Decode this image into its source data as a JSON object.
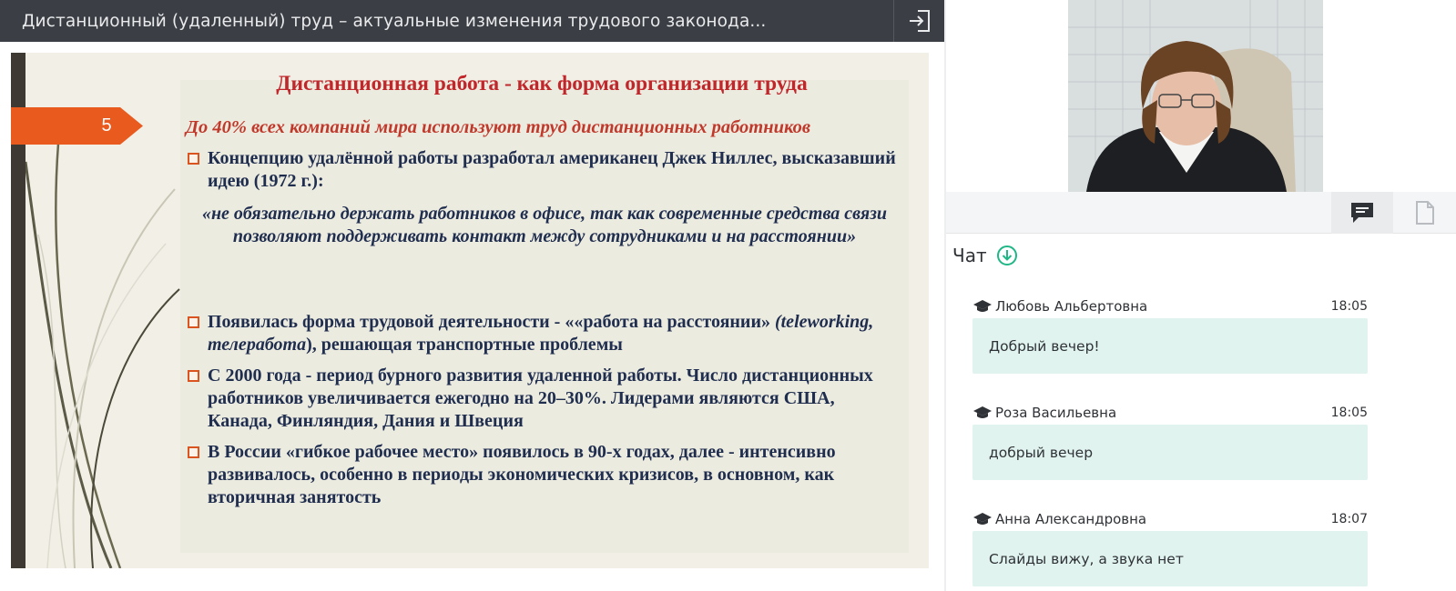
{
  "header": {
    "title": "Дистанционный (удаленный) труд – актуальные изменения трудового законода..."
  },
  "slide": {
    "number": "5",
    "title": "Дистанционная работа - как форма организации труда",
    "subtitle": "До 40% всех компаний мира используют труд дистанционных работников",
    "bullet1": "Концепцию удалённой работы разработал американец Джек Ниллес, высказавший идею (1972 г.):",
    "quote": "«не обязательно держать работников в офисе, так как современные средства связи позволяют поддерживать контакт между сотрудниками и на расстоянии»",
    "bullet2_a": "Появилась форма трудовой деятельности - ««работа на расстоянии» ",
    "bullet2_italic": "(teleworking, телеработа",
    "bullet2_b": "), решающая транспортные проблемы",
    "bullet3": "С 2000 года - период бурного развития удаленной работы. Число дистанционных работников увеличивается ежегодно на 20–30%. Лидерами являются США, Канада, Финляндия, Дания и Швеция",
    "bullet4": "В России «гибкое рабочее место»  появилось в 90-х годах, далее - интенсивно развивалось, особенно  в периоды экономических кризисов, в основном, как вторичная занятость"
  },
  "tabs": [
    {
      "icon": "chat-icon",
      "active": true
    },
    {
      "icon": "document-icon",
      "active": false
    }
  ],
  "chat": {
    "label": "Чат",
    "messages": [
      {
        "author": "Любовь Альбертовна",
        "time": "18:05",
        "text": "Добрый вечер!"
      },
      {
        "author": "Роза Васильевна",
        "time": "18:05",
        "text": "добрый вечер"
      },
      {
        "author": "Анна Александровна",
        "time": "18:07",
        "text": "Слайды вижу, а звука нет"
      }
    ]
  },
  "colors": {
    "topbar": "#3b3e44",
    "slide_title": "#c0262a",
    "slide_text": "#1f2d4e",
    "accent_orange": "#e85a1e",
    "bubble": "#e0f3ef",
    "chat_accent": "#21b687"
  }
}
